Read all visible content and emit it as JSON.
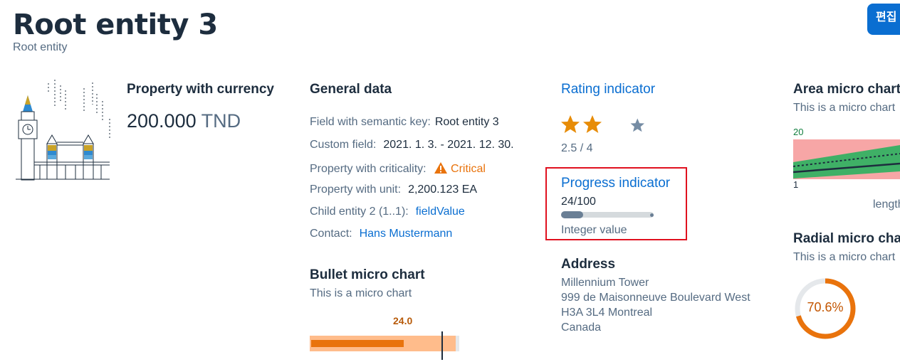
{
  "header": {
    "title": "Root entity 3",
    "subtitle": "Root entity",
    "edit_label": "편집"
  },
  "currency_section": {
    "title": "Property with currency",
    "amount": "200.000",
    "currency": "TND"
  },
  "general": {
    "title": "General data",
    "fields": [
      {
        "label": "Field with semantic key:",
        "value": "Root entity 3"
      },
      {
        "label": "Custom field:",
        "value": "2021. 1. 3. - 2021. 12. 30."
      },
      {
        "label": "Property with criticality:",
        "value": "Critical"
      },
      {
        "label": "Property with unit:",
        "value": "2,200.123 EA"
      },
      {
        "label": "Child entity 2 (1..1):",
        "value": "fieldValue"
      },
      {
        "label": "Contact:",
        "value": "Hans Mustermann"
      }
    ]
  },
  "rating": {
    "title": "Rating indicator",
    "value": 2.5,
    "max": 4,
    "text": "2.5 / 4"
  },
  "progress": {
    "title": "Progress indicator",
    "text": "24/100",
    "fraction": 0.24,
    "caption": "Integer value"
  },
  "address": {
    "title": "Address",
    "lines": [
      "Millennium Tower",
      "999 de Maisonneuve Boulevard West",
      "H3A 3L4 Montreal",
      "Canada"
    ]
  },
  "bullet_chart": {
    "title": "Bullet micro chart",
    "subtitle": "This is a micro chart",
    "value_label": "24.0",
    "value": 24,
    "colors": {
      "actual": "#e9730c",
      "range": "#ffbc8b"
    }
  },
  "area_chart": {
    "title": "Area micro chart",
    "subtitle": "This is a micro chart",
    "max_label": "20",
    "min_label": "1",
    "axis_label": "length"
  },
  "radial_chart": {
    "title": "Radial micro chart",
    "subtitle": "This is a micro chart",
    "value_label": "70.6%",
    "fraction": 0.706,
    "color": "#e9730c"
  },
  "colors": {
    "accent": "#0a6ed1",
    "critical": "#e9730c",
    "error_frame": "#e0111f"
  }
}
